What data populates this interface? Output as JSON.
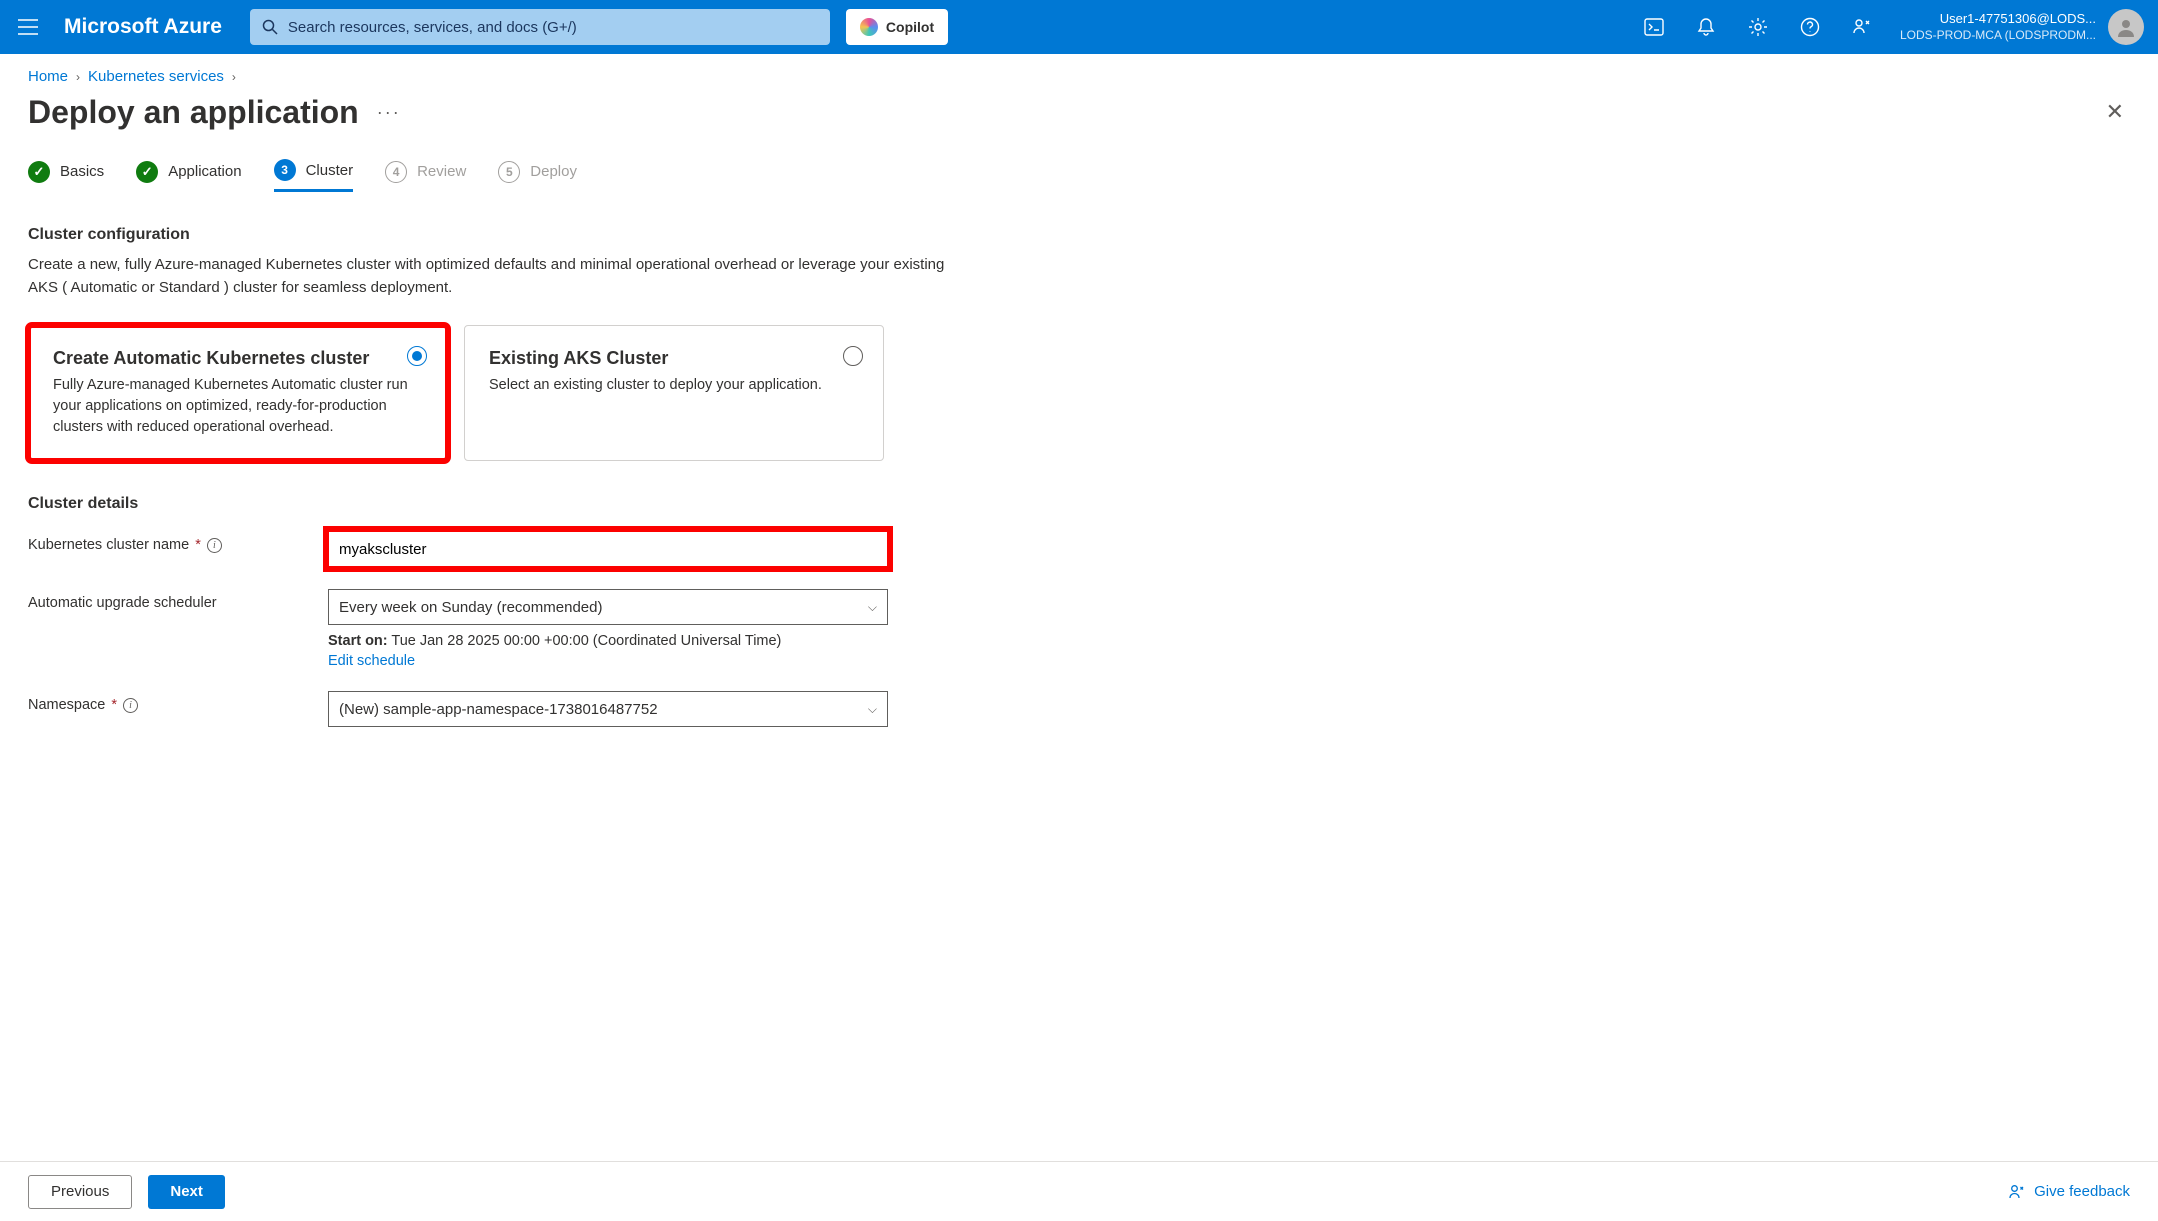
{
  "header": {
    "brand": "Microsoft Azure",
    "search_placeholder": "Search resources, services, and docs (G+/)",
    "copilot_label": "Copilot",
    "user_line1": "User1-47751306@LODS...",
    "user_line2": "LODS-PROD-MCA (LODSPRODM..."
  },
  "breadcrumb": {
    "items": [
      "Home",
      "Kubernetes services"
    ]
  },
  "page": {
    "title": "Deploy an application"
  },
  "tabs": [
    {
      "label": "Basics",
      "state": "done"
    },
    {
      "label": "Application",
      "state": "done"
    },
    {
      "label": "Cluster",
      "state": "active",
      "num": "3"
    },
    {
      "label": "Review",
      "state": "pending",
      "num": "4"
    },
    {
      "label": "Deploy",
      "state": "pending",
      "num": "5"
    }
  ],
  "cluster_config": {
    "title": "Cluster configuration",
    "desc": "Create a new, fully Azure-managed Kubernetes cluster with optimized defaults and minimal operational overhead or leverage your existing AKS ( Automatic or Standard ) cluster for seamless deployment."
  },
  "cards": {
    "create": {
      "title": "Create Automatic Kubernetes cluster",
      "desc": "Fully Azure-managed Kubernetes Automatic cluster run your applications on optimized, ready-for-production clusters with reduced operational overhead.",
      "selected": true
    },
    "existing": {
      "title": "Existing AKS Cluster",
      "desc": "Select an existing cluster to deploy your application.",
      "selected": false
    }
  },
  "details": {
    "title": "Cluster details",
    "name_label": "Kubernetes cluster name",
    "name_value": "myakscluster",
    "scheduler_label": "Automatic upgrade scheduler",
    "scheduler_value": "Every week on Sunday (recommended)",
    "start_label": "Start on:",
    "start_value": "Tue Jan 28 2025 00:00 +00:00 (Coordinated Universal Time)",
    "edit_link": "Edit schedule",
    "namespace_label": "Namespace",
    "namespace_value": "(New) sample-app-namespace-1738016487752"
  },
  "footer": {
    "prev": "Previous",
    "next": "Next",
    "feedback": "Give feedback"
  }
}
